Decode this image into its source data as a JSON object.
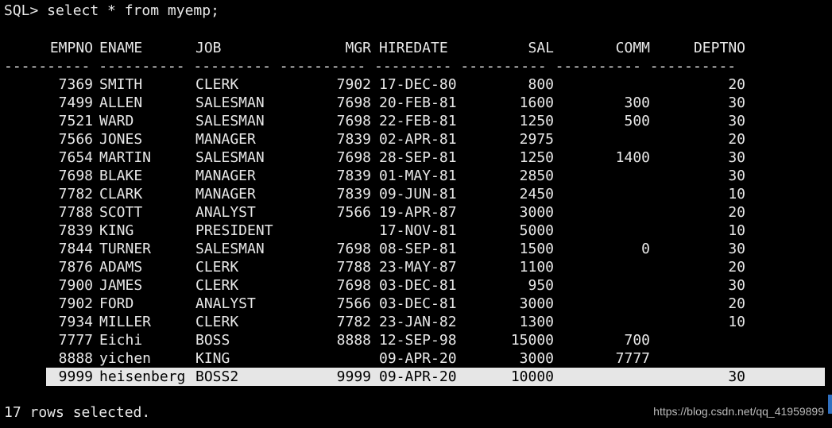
{
  "prompt_line": "SQL> select * from myemp;",
  "columns": [
    "EMPNO",
    "ENAME",
    "JOB",
    "MGR",
    "HIREDATE",
    "SAL",
    "COMM",
    "DEPTNO"
  ],
  "separator": "---------- ---------- --------- ---------- --------- ---------- ---------- ----------",
  "rows": [
    [
      "7369",
      "SMITH",
      "CLERK",
      "7902",
      "17-DEC-80",
      "800",
      "",
      "20"
    ],
    [
      "7499",
      "ALLEN",
      "SALESMAN",
      "7698",
      "20-FEB-81",
      "1600",
      "300",
      "30"
    ],
    [
      "7521",
      "WARD",
      "SALESMAN",
      "7698",
      "22-FEB-81",
      "1250",
      "500",
      "30"
    ],
    [
      "7566",
      "JONES",
      "MANAGER",
      "7839",
      "02-APR-81",
      "2975",
      "",
      "20"
    ],
    [
      "7654",
      "MARTIN",
      "SALESMAN",
      "7698",
      "28-SEP-81",
      "1250",
      "1400",
      "30"
    ],
    [
      "7698",
      "BLAKE",
      "MANAGER",
      "7839",
      "01-MAY-81",
      "2850",
      "",
      "30"
    ],
    [
      "7782",
      "CLARK",
      "MANAGER",
      "7839",
      "09-JUN-81",
      "2450",
      "",
      "10"
    ],
    [
      "7788",
      "SCOTT",
      "ANALYST",
      "7566",
      "19-APR-87",
      "3000",
      "",
      "20"
    ],
    [
      "7839",
      "KING",
      "PRESIDENT",
      "",
      "17-NOV-81",
      "5000",
      "",
      "10"
    ],
    [
      "7844",
      "TURNER",
      "SALESMAN",
      "7698",
      "08-SEP-81",
      "1500",
      "0",
      "30"
    ],
    [
      "7876",
      "ADAMS",
      "CLERK",
      "7788",
      "23-MAY-87",
      "1100",
      "",
      "20"
    ],
    [
      "7900",
      "JAMES",
      "CLERK",
      "7698",
      "03-DEC-81",
      "950",
      "",
      "30"
    ],
    [
      "7902",
      "FORD",
      "ANALYST",
      "7566",
      "03-DEC-81",
      "3000",
      "",
      "20"
    ],
    [
      "7934",
      "MILLER",
      "CLERK",
      "7782",
      "23-JAN-82",
      "1300",
      "",
      "10"
    ],
    [
      "7777",
      "Eichi",
      "BOSS",
      "8888",
      "12-SEP-98",
      "15000",
      "700",
      ""
    ],
    [
      "8888",
      "yichen",
      "KING",
      "",
      "09-APR-20",
      "3000",
      "7777",
      ""
    ],
    [
      "9999",
      "heisenberg",
      "BOSS2",
      "9999",
      "09-APR-20",
      "10000",
      "",
      "30"
    ]
  ],
  "selected_row_index": 16,
  "status_line": "17 rows selected.",
  "watermark": "https://blog.csdn.net/qq_41959899"
}
